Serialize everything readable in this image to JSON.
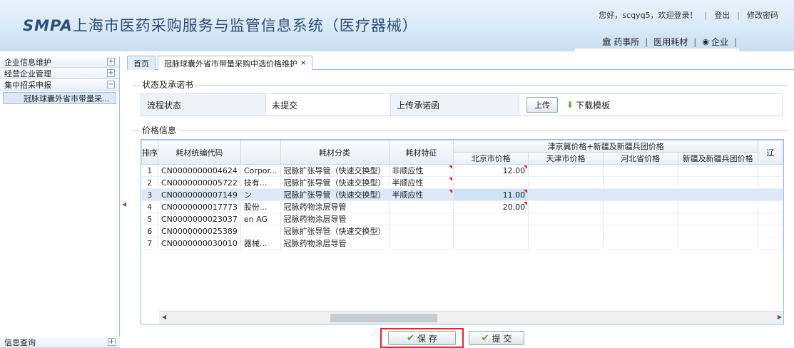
{
  "header": {
    "brand": "SMPA",
    "title": "上海市医药采购服务与监管信息系统（医疗器械）",
    "greeting": "您好，scqyq5，欢迎登录！",
    "logout": "登出",
    "change_password": "修改密码",
    "nav": [
      "药事所",
      "医用耗材",
      "企业"
    ]
  },
  "sidebar": {
    "items": [
      {
        "label": "企业信息维护",
        "expander": "+"
      },
      {
        "label": "经营企业管理",
        "expander": "+"
      },
      {
        "label": "集中招采申报",
        "expander": "−"
      }
    ],
    "sub_item": "冠脉球囊外省市带量采...",
    "bottom_item": {
      "label": "信息查询",
      "expander": "+"
    }
  },
  "tabs": {
    "home": "首页",
    "active": "冠脉球囊外省市带量采购中选价格维护",
    "close": "×"
  },
  "status_section": {
    "legend": "状态及承诺书",
    "flow_label": "流程状态",
    "flow_value": "未提交",
    "upload_label": "上传承诺函",
    "upload_button": "上传",
    "download_template": "下载模板"
  },
  "price_section": {
    "legend": "价格信息",
    "columns": {
      "seq": "排序",
      "code": "耗材统编代码",
      "category": "耗材分类",
      "feature": "耗材特征",
      "group": "津京冀价格+新疆及新疆兵团价格",
      "beijing": "北京市价格",
      "tianjin": "天津市价格",
      "hebei": "河北省价格",
      "xinjiang": "新疆及新疆兵团价格",
      "extra": "辽"
    },
    "rows": [
      {
        "seq": "1",
        "code": "CN0000000004624",
        "company": "Corpor...",
        "category": "冠脉扩张导管（快速交换型）",
        "feature": "非顺应性",
        "beijing": "12.00"
      },
      {
        "seq": "2",
        "code": "CN0000000005722",
        "company": "技有...",
        "category": "冠脉扩张导管（快速交换型）",
        "feature": "半顺应性",
        "beijing": ""
      },
      {
        "seq": "3",
        "code": "CN0000000007149",
        "company": "ン",
        "category": "冠脉扩张导管（快速交换型）",
        "feature": "半顺应性",
        "beijing": "11.00"
      },
      {
        "seq": "4",
        "code": "CN0000000017773",
        "company": "股份...",
        "category": "冠脉药物涂层导管",
        "feature": "",
        "beijing": "20.00"
      },
      {
        "seq": "5",
        "code": "CN0000000023037",
        "company": "en AG",
        "category": "冠脉药物涂层导管",
        "feature": "",
        "beijing": ""
      },
      {
        "seq": "6",
        "code": "CN0000000025389",
        "company": "",
        "category": "冠脉扩张导管（快速交换型）",
        "feature": "",
        "beijing": ""
      },
      {
        "seq": "7",
        "code": "CN0000000030010",
        "company": "器械...",
        "category": "冠脉药物涂层导管",
        "feature": "",
        "beijing": ""
      }
    ]
  },
  "footer": {
    "save": "保 存",
    "submit": "提 交"
  }
}
